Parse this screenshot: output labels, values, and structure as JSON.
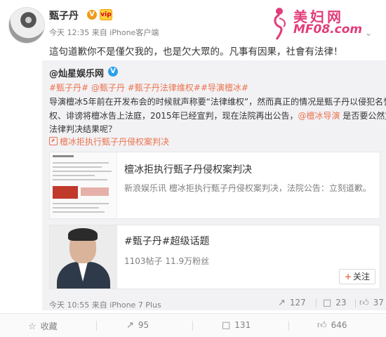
{
  "header": {
    "author": "甄子丹",
    "verified_badge": "V",
    "vip_badge": "vip",
    "meta": "今天 12:35 来自 iPhone客户端",
    "main_text": "這句道歉你不是僅欠我的，也是欠大眾的。凡事有因果，社會有法律！"
  },
  "watermark": {
    "cn": "美妇网",
    "en": "MF08.com"
  },
  "repost": {
    "author": "@灿星娱乐网",
    "verified_badge": "V",
    "tags": "#甄子丹# @甄子丹 #甄子丹法律维权##导演檀冰#",
    "line1": "导演檀冰5年前在开发布会的时候就声称要“法律维权”，然而真正的情况是甄子丹以侵犯名誉",
    "line2a": "权、诽谤将檀冰告上法庭，2015年已经宣判，现在法院再出公告，",
    "line2_mention": "@檀冰导演",
    "line2b": " 是否要公然对抗",
    "line3": "法律判决结果呢？",
    "weibo_link": "檀冰拒执行甄子丹侵权案判决",
    "card1": {
      "title": "檀冰拒执行甄子丹侵权案判决",
      "desc": "新浪娱乐讯 檀冰拒执行甄子丹侵权案判决，法院公告：立刻道歉。"
    },
    "card2": {
      "title": "#甄子丹#超级话题",
      "stats": "1103帖子 11.9万粉丝",
      "follow_label": "关注"
    },
    "time": "今天 10:55 来自 iPhone 7 Plus",
    "repost_count": "127",
    "comment_count": "23",
    "like_count": "37"
  },
  "actions": {
    "collect": "收藏",
    "repost": "95",
    "comment": "131",
    "like": "646"
  },
  "colors": {
    "link": "#eb7350",
    "watermark": "#e23c7a",
    "verified_gold": "#f09a1a",
    "verified_blue": "#2aa1ec"
  }
}
